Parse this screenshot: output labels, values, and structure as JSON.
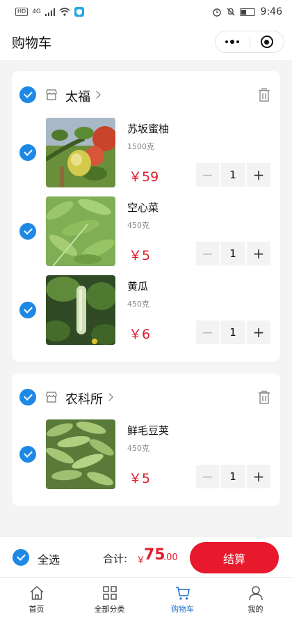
{
  "status_bar": {
    "left": [
      "HD",
      "4G"
    ],
    "time": "9:46"
  },
  "nav": {
    "title": "购物车"
  },
  "shops": [
    {
      "name": "太福",
      "items": [
        {
          "name": "苏坂蜜柚",
          "weight": "1500克",
          "price": "￥59",
          "qty": "1",
          "image": "pomelo-photo"
        },
        {
          "name": "空心菜",
          "weight": "450克",
          "price": "￥5",
          "qty": "1",
          "image": "water-spinach-photo"
        },
        {
          "name": "黄瓜",
          "weight": "450克",
          "price": "￥6",
          "qty": "1",
          "image": "cucumber-photo"
        }
      ]
    },
    {
      "name": "农科所",
      "items": [
        {
          "name": "鲜毛豆荚",
          "weight": "450克",
          "price": "￥5",
          "qty": "1",
          "image": "edamame-photo"
        }
      ]
    }
  ],
  "stepper": {
    "minus": "−",
    "plus": "+"
  },
  "footer": {
    "select_all": "全选",
    "total_label": "合计:",
    "total_symbol": "￥",
    "total_int": "75",
    "total_dec": ".00",
    "checkout": "结算"
  },
  "tabs": [
    {
      "label": "首页",
      "icon": "home-icon"
    },
    {
      "label": "全部分类",
      "icon": "grid-icon"
    },
    {
      "label": "购物车",
      "icon": "cart-icon",
      "active": true
    },
    {
      "label": "我的",
      "icon": "user-icon"
    }
  ],
  "colors": {
    "accent": "#1e88e5",
    "price": "#e21b2c",
    "checkout": "#e8192c",
    "tab_active": "#1e6fc8"
  }
}
